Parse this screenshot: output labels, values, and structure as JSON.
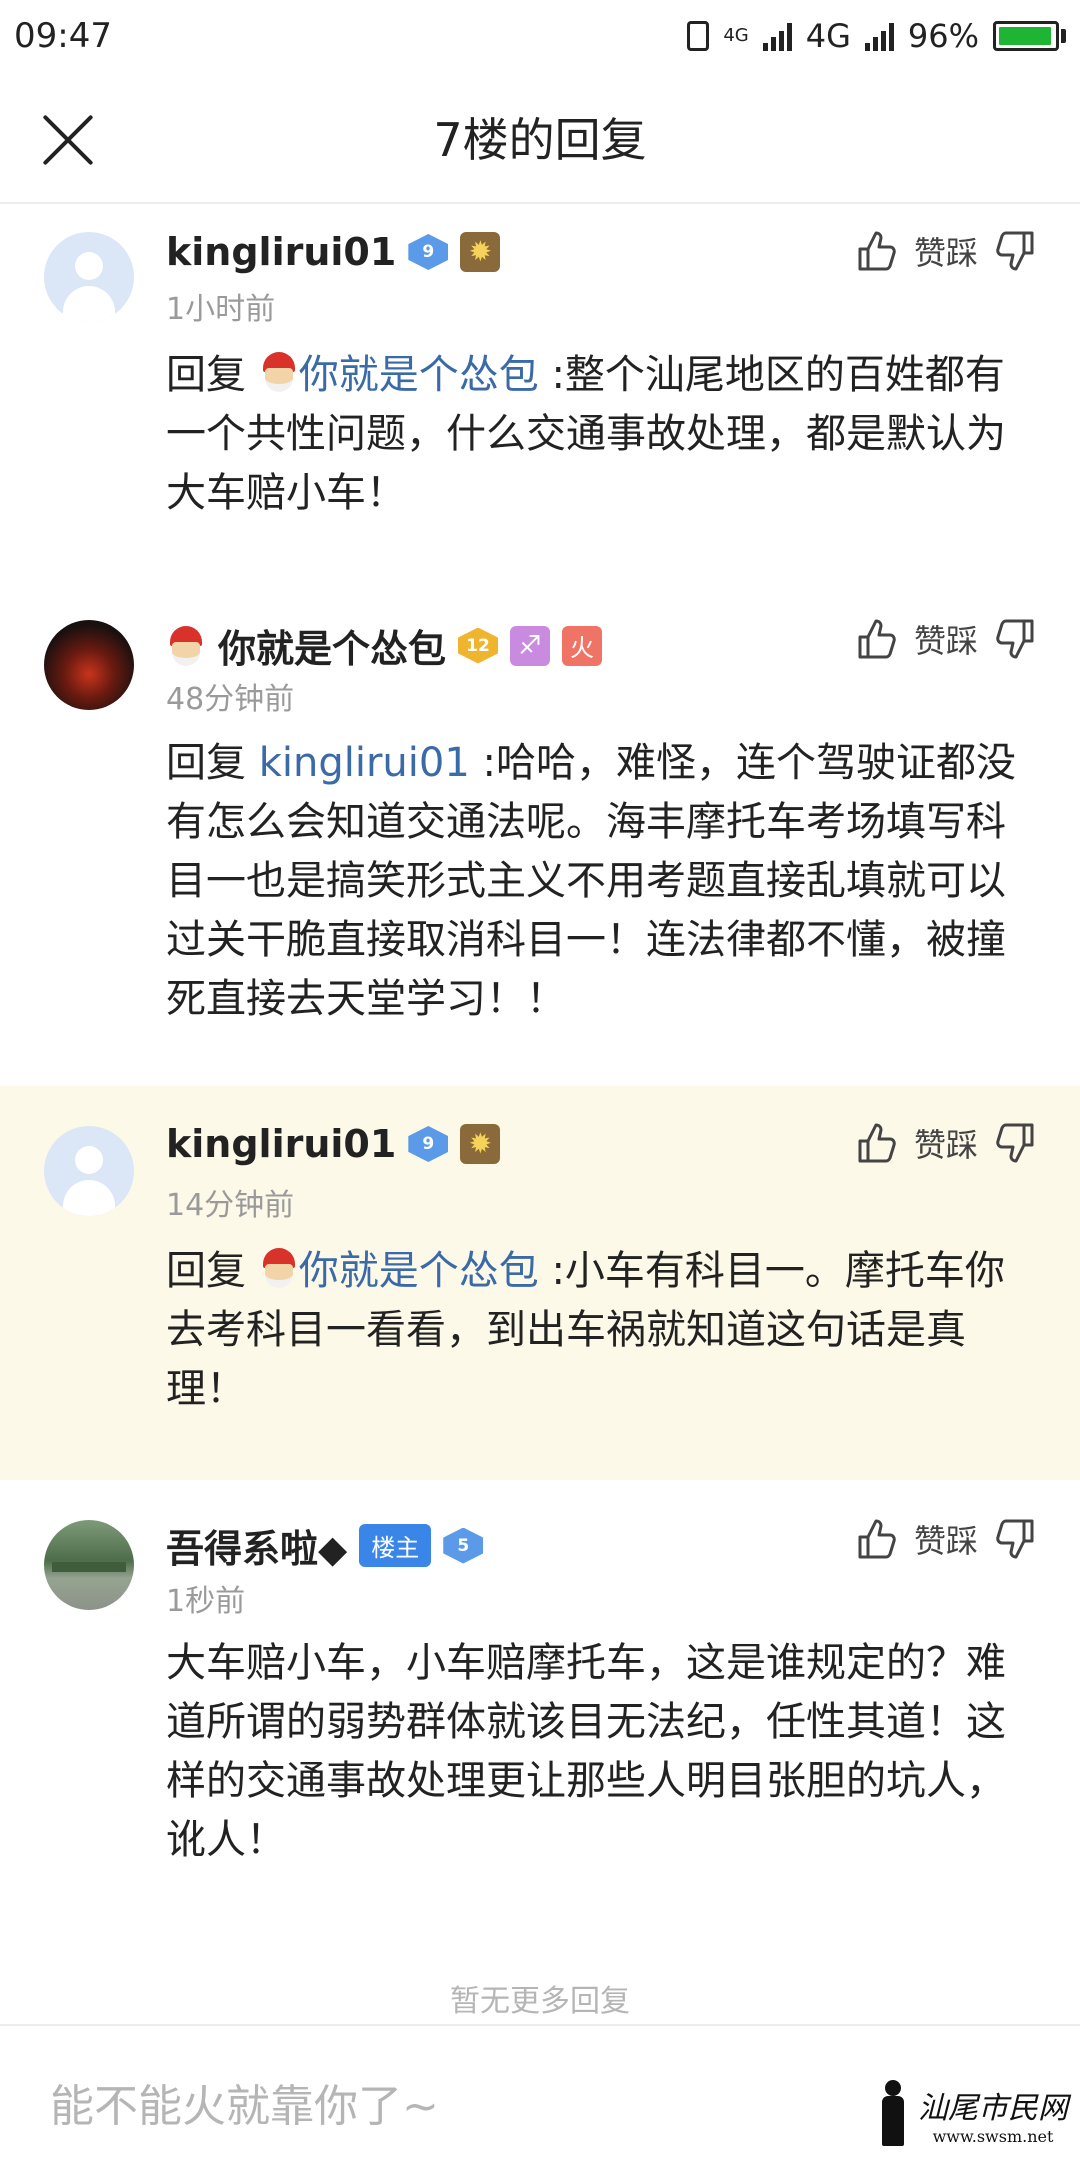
{
  "status_bar": {
    "time": "09:47",
    "network_small": "4G",
    "network": "4G",
    "battery": "96%",
    "battery_level": 0.96,
    "battery_color": "#1db533"
  },
  "header": {
    "title": "7楼的回复"
  },
  "replies": [
    {
      "username": "kinglirui01",
      "level": "9",
      "time": "1小时前",
      "like_label": "赞踩",
      "prefix": "回复 ",
      "mention": "你就是个怂包",
      "text": ":整个汕尾地区的百姓都有一个共性问题，什么交通事故处理，都是默认为大车赔小车！"
    },
    {
      "username": "你就是个怂包",
      "level": "12",
      "zodiac": "♐",
      "fire": "火",
      "time": "48分钟前",
      "like_label": "赞踩",
      "prefix": "回复 ",
      "mention": "kinglirui01",
      "text": ":哈哈，难怪，连个驾驶证都没有怎么会知道交通法呢。海丰摩托车考场填写科目一也是搞笑形式主义不用考题直接乱填就可以过关干脆直接取消科目一！连法律都不懂，被撞死直接去天堂学习！！"
    },
    {
      "username": "kinglirui01",
      "level": "9",
      "time": "14分钟前",
      "like_label": "赞踩",
      "prefix": "回复 ",
      "mention": "你就是个怂包",
      "text": ":小车有科目一。摩托车你去考科目一看看，到出车祸就知道这句话是真理！"
    },
    {
      "username": "吾得系啦◆",
      "owner_tag": "楼主",
      "level": "5",
      "time": "1秒前",
      "like_label": "赞踩",
      "text": "大车赔小车，小车赔摩托车，这是谁规定的？难道所谓的弱势群体就该目无法纪，任性其道！这样的交通事故处理更让那些人明目张胆的坑人，讹人！"
    }
  ],
  "footer": {
    "no_more": "暂无更多回复",
    "input_placeholder": "能不能火就靠你了~"
  },
  "watermark": {
    "name": "汕尾市民网",
    "url": "www.swsm.net"
  }
}
